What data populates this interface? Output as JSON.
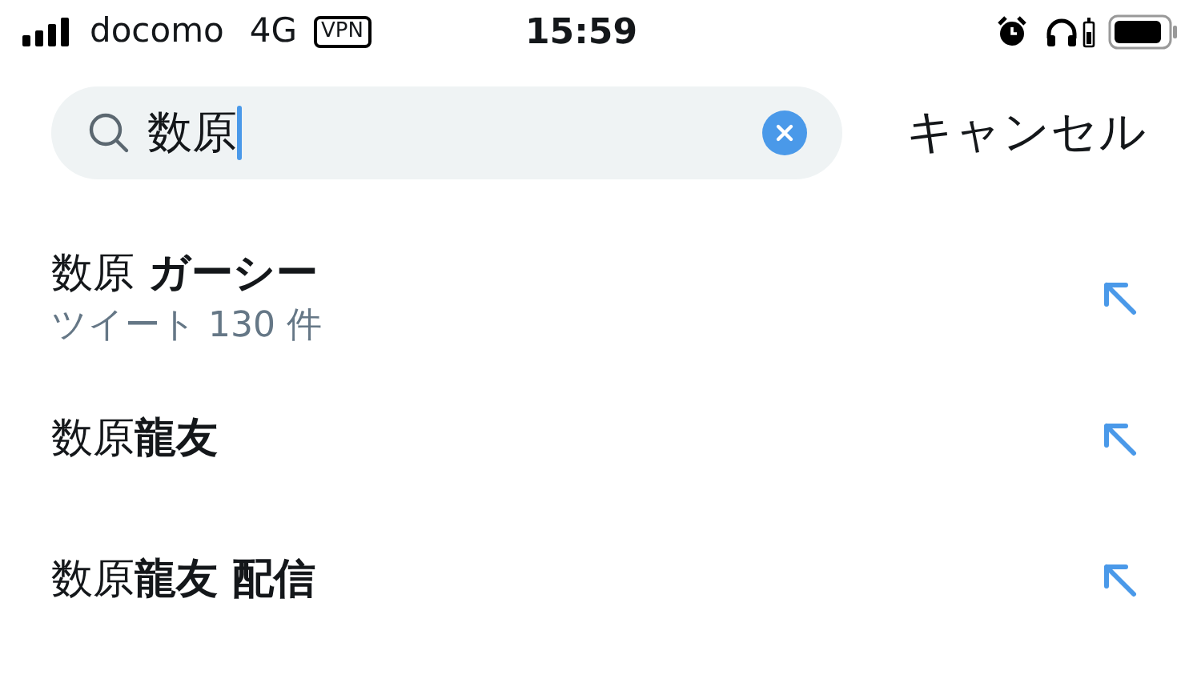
{
  "status_bar": {
    "carrier": "docomo",
    "network": "4G",
    "vpn": "VPN",
    "time": "15:59"
  },
  "search": {
    "value": "数原",
    "cancel": "キャンセル"
  },
  "suggestions": [
    {
      "text": "数原 **ガーシー**",
      "subtitle": "ツイート 130 件"
    },
    {
      "text": "数原**龍友**"
    },
    {
      "text": "数原**龍友 配信**"
    }
  ]
}
